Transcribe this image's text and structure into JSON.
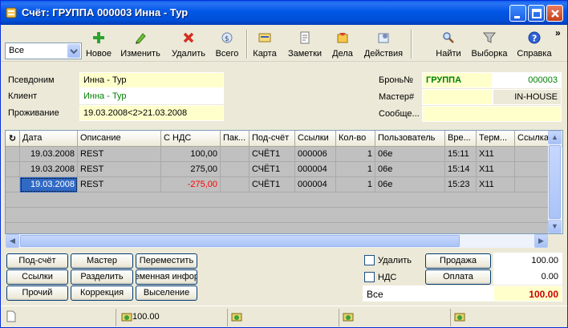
{
  "window": {
    "title": "Счёт: ГРУППА 000003 Инна - Тур"
  },
  "toolbar": {
    "filter_value": "Все",
    "buttons": [
      {
        "label": "Новое",
        "icon": "plus-icon"
      },
      {
        "label": "Изменить",
        "icon": "pencil-icon"
      },
      {
        "label": "Удалить",
        "icon": "delete-icon"
      },
      {
        "label": "Всего",
        "icon": "total-icon"
      },
      {
        "label": "Карта",
        "icon": "card-icon"
      },
      {
        "label": "Заметки",
        "icon": "notes-icon"
      },
      {
        "label": "Дела",
        "icon": "tasks-icon"
      },
      {
        "label": "Действия",
        "icon": "actions-icon"
      },
      {
        "label": "Найти",
        "icon": "search-icon"
      },
      {
        "label": "Выборка",
        "icon": "filter-icon"
      },
      {
        "label": "Справка",
        "icon": "help-icon"
      }
    ],
    "more": "»"
  },
  "info": {
    "alias_label": "Псевдоним",
    "alias_value": "Инна - Тур",
    "client_label": "Клиент",
    "client_value": "Инна - Тур",
    "stay_label": "Проживание",
    "stay_value": "19.03.2008<2>21.03.2008"
  },
  "booking": {
    "booking_label": "Бронь№",
    "booking_group": "ГРУППА",
    "booking_number": "000003",
    "master_label": "Мастер#",
    "master_value": "IN-HOUSE",
    "message_label": "Сообще..."
  },
  "grid": {
    "columns": [
      "Дата",
      "Описание",
      "С НДС",
      "Пак...",
      "Под-счёт",
      "Ссылки",
      "Кол-во",
      "Пользователь",
      "Вре...",
      "Терм...",
      "Ссылка"
    ],
    "rows": [
      {
        "date": "19.03.2008",
        "desc": "REST",
        "amount": "100,00",
        "pack": "",
        "sub": "СЧЁТ1",
        "ref": "000006",
        "qty": "1",
        "user": "06е",
        "time": "15:11",
        "term": "X11",
        "link": ""
      },
      {
        "date": "19.03.2008",
        "desc": "REST",
        "amount": "275,00",
        "pack": "",
        "sub": "СЧЁТ1",
        "ref": "000004",
        "qty": "1",
        "user": "06е",
        "time": "15:14",
        "term": "X11",
        "link": ""
      },
      {
        "date": "19.03.2008",
        "desc": "REST",
        "amount": "-275,00",
        "pack": "",
        "sub": "СЧЁТ1",
        "ref": "000004",
        "qty": "1",
        "user": "06е",
        "time": "15:23",
        "term": "X11",
        "link": ""
      }
    ]
  },
  "actions": {
    "subaccount": "Под-счёт",
    "master": "Мастер",
    "move": "Переместить",
    "links": "Ссылки",
    "split": "Разделить",
    "temp_info": "Временная информ",
    "misc": "Прочий",
    "correction": "Коррекция",
    "checkout": "Выселение"
  },
  "totals": {
    "delete_label": "Удалить",
    "vat_label": "НДС",
    "sale_label": "Продажа",
    "sale_value": "100.00",
    "payment_label": "Оплата",
    "payment_value": "0.00",
    "all_label": "Все",
    "all_value": "100.00"
  },
  "status": {
    "amount": "100.00"
  },
  "colors": {
    "negative": "#ff0000",
    "total": "#cc0000",
    "group": "#008000",
    "number": "#008000",
    "highlight": "#ffffcc"
  }
}
